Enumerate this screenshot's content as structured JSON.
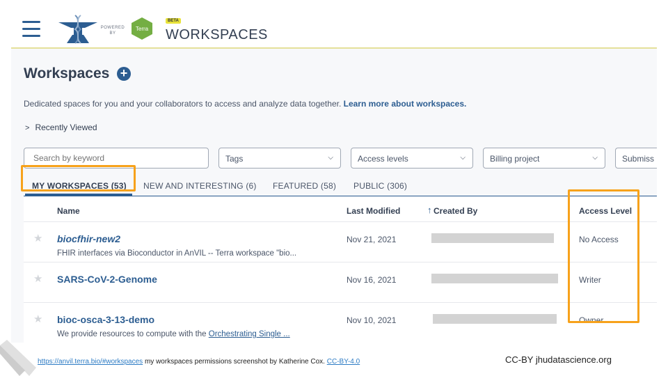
{
  "header": {
    "powered_by": "POWERED BY",
    "terra_label": "Terra",
    "beta_badge": "BETA",
    "app_title": "WORKSPACES"
  },
  "page": {
    "title": "Workspaces",
    "description": "Dedicated spaces for you and your collaborators to access and analyze data together.",
    "learn_more": "Learn more about workspaces.",
    "recently_viewed": "Recently Viewed"
  },
  "filters": {
    "search_placeholder": "Search by keyword",
    "tags": "Tags",
    "access_levels": "Access levels",
    "billing_project": "Billing project",
    "submission": "Submiss"
  },
  "tabs": [
    {
      "label": "MY WORKSPACES (53)",
      "active": true
    },
    {
      "label": "NEW AND INTERESTING (6)",
      "active": false
    },
    {
      "label": "FEATURED (58)",
      "active": false
    },
    {
      "label": "PUBLIC (306)",
      "active": false
    }
  ],
  "table": {
    "columns": {
      "name": "Name",
      "last_modified": "Last Modified",
      "sort_arrow": "↑",
      "created_by": "Created By",
      "access_level": "Access Level"
    },
    "rows": [
      {
        "name": "biocfhir-new2",
        "description": "FHIR interfaces via Bioconductor in AnVIL -- Terra workspace \"bio...",
        "last_modified": "Nov 21, 2021",
        "access_level": "No Access"
      },
      {
        "name": "SARS-CoV-2-Genome",
        "description": "",
        "last_modified": "Nov 16, 2021",
        "access_level": "Writer"
      },
      {
        "name": "bioc-osca-3-13-demo",
        "description_prefix": "We provide resources to compute with the ",
        "description_link": "Orchestrating Single ...",
        "last_modified": "Nov 10, 2021",
        "access_level": "Owner"
      }
    ]
  },
  "footer": {
    "url": "https://anvil.terra.bio/#workspaces",
    "caption": " my workspaces permissions screenshot by Katherine Cox. ",
    "license": "CC-BY-4.0",
    "credit": "CC-BY  jhudatascience.org"
  },
  "colors": {
    "accent": "#2c5d91",
    "highlight": "#f7a21b",
    "beta": "#e8e33a",
    "terra_green": "#74ae43"
  }
}
